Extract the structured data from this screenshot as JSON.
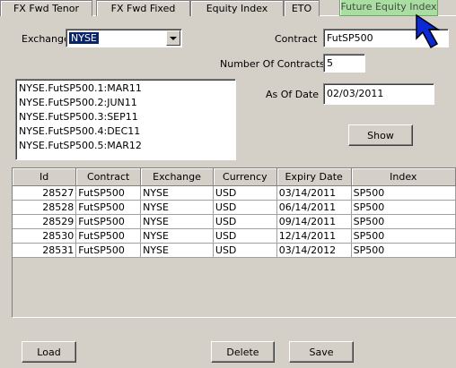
{
  "tabs": [
    {
      "label": "FX Fwd Tenor"
    },
    {
      "label": "FX Fwd Fixed"
    },
    {
      "label": "Equity Index"
    },
    {
      "label": "ETO"
    },
    {
      "label": "Future Equity Index"
    }
  ],
  "form": {
    "exchange_label": "Exchange",
    "exchange_value": "NYSE",
    "contract_label": "Contract",
    "contract_value": "FutSP500",
    "num_contracts_label": "Number Of Contracts",
    "num_contracts_value": "5",
    "as_of_label": "As Of Date",
    "as_of_value": "02/03/2011"
  },
  "contract_list": [
    "NYSE.FutSP500.1:MAR11",
    "NYSE.FutSP500.2:JUN11",
    "NYSE.FutSP500.3:SEP11",
    "NYSE.FutSP500.4:DEC11",
    "NYSE.FutSP500.5:MAR12"
  ],
  "buttons": {
    "show": "Show",
    "load": "Load",
    "delete": "Delete",
    "save": "Save"
  },
  "grid": {
    "columns": [
      "Id",
      "Contract",
      "Exchange",
      "Currency",
      "Expiry Date",
      "Index"
    ],
    "rows": [
      [
        "28527",
        "FutSP500",
        "NYSE",
        "USD",
        "03/14/2011",
        "SP500"
      ],
      [
        "28528",
        "FutSP500",
        "NYSE",
        "USD",
        "06/14/2011",
        "SP500"
      ],
      [
        "28529",
        "FutSP500",
        "NYSE",
        "USD",
        "09/14/2011",
        "SP500"
      ],
      [
        "28530",
        "FutSP500",
        "NYSE",
        "USD",
        "12/14/2011",
        "SP500"
      ],
      [
        "28531",
        "FutSP500",
        "NYSE",
        "USD",
        "03/14/2012",
        "SP500"
      ]
    ]
  },
  "colors": {
    "active_tab": "#a8dea0",
    "selection": "#0a246a",
    "cursor": "#0a2ad8"
  }
}
